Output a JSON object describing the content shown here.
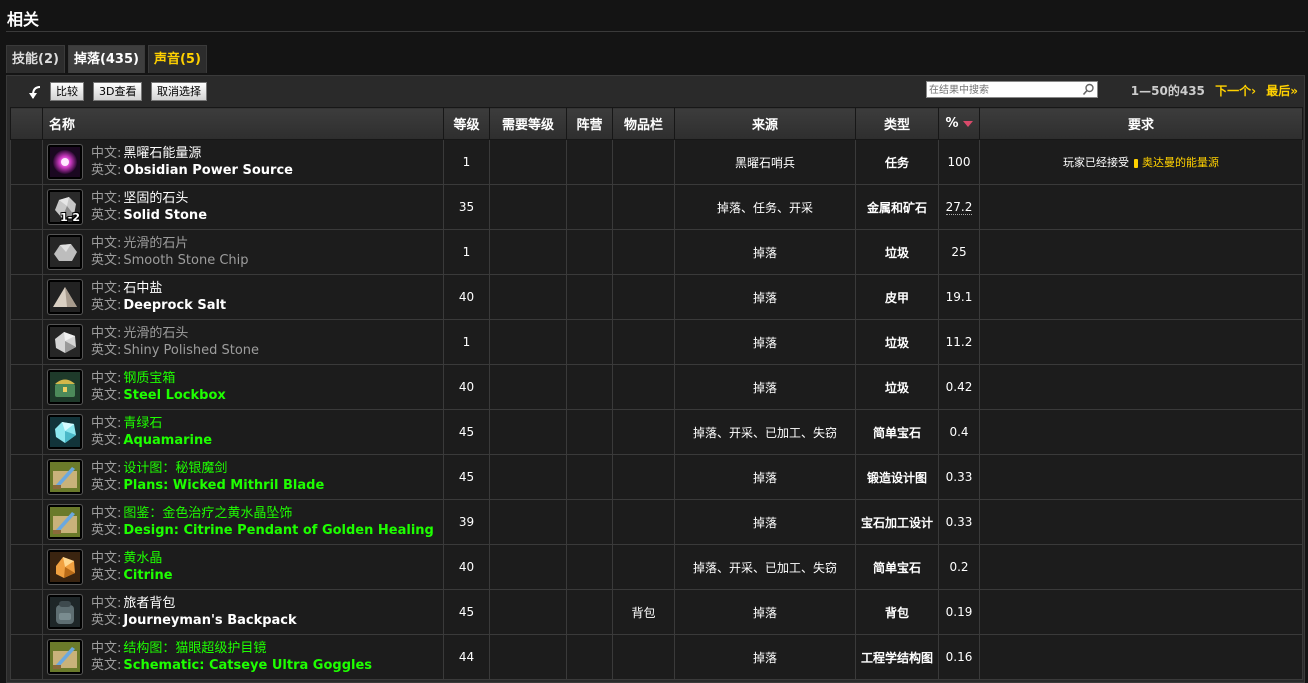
{
  "section_title": "相关",
  "tabs": [
    {
      "label": "技能(2)"
    },
    {
      "label": "掉落(435)"
    },
    {
      "label": "声音(5)"
    }
  ],
  "toolbar": {
    "compare_label": "比较",
    "view3d_label": "3D查看",
    "deselect_label": "取消选择",
    "search_placeholder": "在结果中搜索",
    "range_text": "1—50的435",
    "next_label": "下一个›",
    "last_label": "最后»"
  },
  "columns": {
    "name": "名称",
    "level": "等级",
    "req_level": "需要等级",
    "faction": "阵营",
    "slot": "物品栏",
    "source": "来源",
    "type": "类型",
    "percent": "%",
    "requirement": "要求"
  },
  "labels": {
    "zh": "中文:",
    "en": "英文:"
  },
  "colors": {
    "quality_green": "#1eff00",
    "quality_grey": "#9d9d9d",
    "quality_white": "#ffffff",
    "accent_gold": "#ffd100",
    "sort_indicator": "#d84a6a"
  },
  "rows": [
    {
      "icon": "obsidian-power-source-icon",
      "quality": "white",
      "zh": "黑曜石能量源",
      "en": "Obsidian Power Source",
      "level": "1",
      "slot": "",
      "source": "黑曜石哨兵",
      "type": "任务",
      "percent": "100",
      "requirement_text": "玩家已经接受",
      "requirement_link": "奥达曼的能量源"
    },
    {
      "icon": "solid-stone-icon",
      "quality": "white",
      "zh": "坚固的石头",
      "en": "Solid Stone",
      "stack": "1-2",
      "level": "35",
      "slot": "",
      "source": "掉落、任务、开采",
      "type": "金属和矿石",
      "percent": "27.2"
    },
    {
      "icon": "smooth-stone-chip-icon",
      "quality": "grey",
      "zh": "光滑的石片",
      "en": "Smooth Stone Chip",
      "level": "1",
      "slot": "",
      "source": "掉落",
      "type": "垃圾",
      "percent": "25"
    },
    {
      "icon": "deeprock-salt-icon",
      "quality": "white",
      "zh": "石中盐",
      "en": "Deeprock Salt",
      "level": "40",
      "slot": "",
      "source": "掉落",
      "type": "皮甲",
      "percent": "19.1"
    },
    {
      "icon": "shiny-polished-stone-icon",
      "quality": "grey",
      "zh": "光滑的石头",
      "en": "Shiny Polished Stone",
      "level": "1",
      "slot": "",
      "source": "掉落",
      "type": "垃圾",
      "percent": "11.2"
    },
    {
      "icon": "steel-lockbox-icon",
      "quality": "green",
      "zh": "钢质宝箱",
      "en": "Steel Lockbox",
      "level": "40",
      "slot": "",
      "source": "掉落",
      "type": "垃圾",
      "percent": "0.42"
    },
    {
      "icon": "aquamarine-icon",
      "quality": "green",
      "zh": "青绿石",
      "en": "Aquamarine",
      "level": "45",
      "slot": "",
      "source": "掉落、开采、已加工、失窃",
      "type": "简单宝石",
      "percent": "0.4"
    },
    {
      "icon": "plans-scroll-icon",
      "quality": "green",
      "zh": "设计图：秘银魔剑",
      "en": "Plans: Wicked Mithril Blade",
      "level": "45",
      "slot": "",
      "source": "掉落",
      "type": "锻造设计图",
      "percent": "0.33"
    },
    {
      "icon": "design-scroll-icon",
      "quality": "green",
      "zh": "图鉴：金色治疗之黄水晶坠饰",
      "en": "Design: Citrine Pendant of Golden Healing",
      "level": "39",
      "slot": "",
      "source": "掉落",
      "type": "宝石加工设计",
      "percent": "0.33"
    },
    {
      "icon": "citrine-icon",
      "quality": "green",
      "zh": "黄水晶",
      "en": "Citrine",
      "level": "40",
      "slot": "",
      "source": "掉落、开采、已加工、失窃",
      "type": "简单宝石",
      "percent": "0.2"
    },
    {
      "icon": "backpack-icon",
      "quality": "white",
      "zh": "旅者背包",
      "en": "Journeyman's Backpack",
      "level": "45",
      "slot": "背包",
      "source": "掉落",
      "type": "背包",
      "percent": "0.19"
    },
    {
      "icon": "schematic-scroll-icon",
      "quality": "green",
      "zh": "结构图：猫眼超级护目镜",
      "en": "Schematic: Catseye Ultra Goggles",
      "level": "44",
      "slot": "",
      "source": "掉落",
      "type": "工程学结构图",
      "percent": "0.16"
    }
  ]
}
